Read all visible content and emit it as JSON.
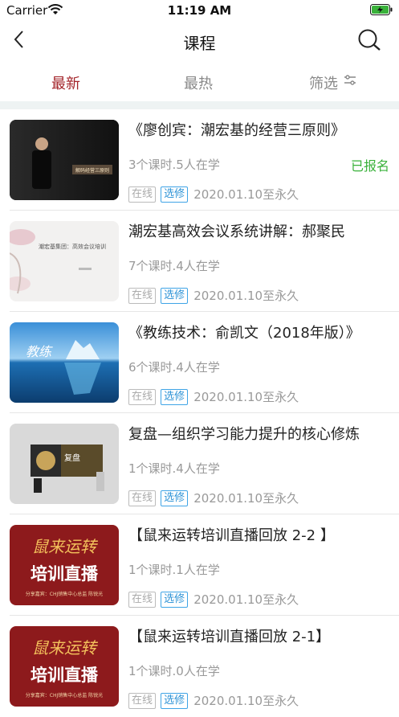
{
  "status": {
    "carrier": "Carrier",
    "time": "11:19 AM"
  },
  "nav": {
    "title": "课程"
  },
  "tabs": [
    {
      "label": "最新"
    },
    {
      "label": "最热"
    },
    {
      "label": "筛选"
    }
  ],
  "courses": [
    {
      "title": "《廖创宾：潮宏基的经营三原则》",
      "meta": "3个课时.5人在学",
      "status": "已报名",
      "tag_mode": "在线",
      "tag_type": "选修",
      "date": "2020.01.10至永久",
      "thumb_text": "解码经营三原则"
    },
    {
      "title": "潮宏基高效会议系统讲解：郝聚民",
      "meta": "7个课时.4人在学",
      "tag_mode": "在线",
      "tag_type": "选修",
      "date": "2020.01.10至永久",
      "thumb_text": "潮宏基集团：高效会议培训"
    },
    {
      "title": "《教练技术：俞凯文（2018年版）》",
      "meta": "6个课时.4人在学",
      "tag_mode": "在线",
      "tag_type": "选修",
      "date": "2020.01.10至永久",
      "thumb_text": "教练"
    },
    {
      "title": "复盘—组织学习能力提升的核心修炼",
      "meta": "1个课时.4人在学",
      "tag_mode": "在线",
      "tag_type": "选修",
      "date": "2020.01.10至永久",
      "thumb_text": "复盘"
    },
    {
      "title": "【鼠来运转培训直播回放 2-2 】",
      "meta": "1个课时.1人在学",
      "tag_mode": "在线",
      "tag_type": "选修",
      "date": "2020.01.10至永久",
      "thumb_top": "鼠来运转",
      "thumb_main": "培训直播",
      "thumb_sub": "分享嘉宾：CHJ销售中心总监 陈锐光"
    },
    {
      "title": "【鼠来运转培训直播回放 2-1】",
      "meta": "1个课时.0人在学",
      "tag_mode": "在线",
      "tag_type": "选修",
      "date": "2020.01.10至永久",
      "thumb_top": "鼠来运转",
      "thumb_main": "培训直播",
      "thumb_sub": "分享嘉宾：CHJ销售中心总监 陈锐光"
    }
  ],
  "colors": {
    "accent": "#a3242a",
    "enrolled": "#39b13a",
    "tag_blue": "#2e93d6"
  }
}
